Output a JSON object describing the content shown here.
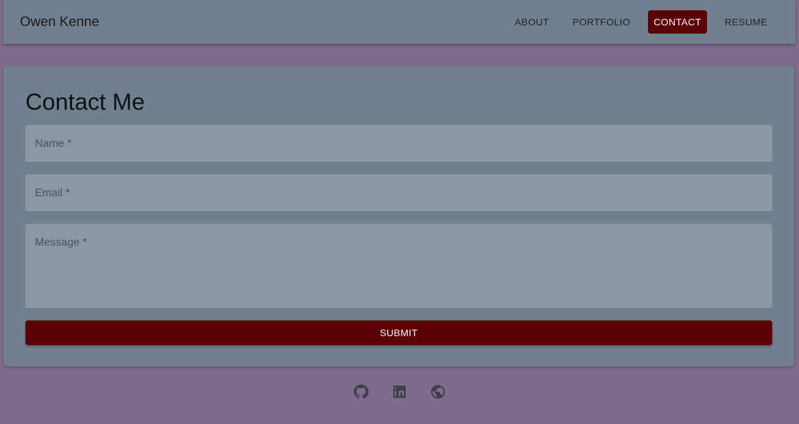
{
  "header": {
    "brand": "Owen Kenne",
    "nav": [
      {
        "label": "ABOUT",
        "active": false
      },
      {
        "label": "PORTFOLIO",
        "active": false
      },
      {
        "label": "CONTACT",
        "active": true
      },
      {
        "label": "RESUME",
        "active": false
      }
    ]
  },
  "contact": {
    "title": "Contact Me",
    "name_placeholder": "Name *",
    "email_placeholder": "Email *",
    "message_placeholder": "Message *",
    "submit_label": "SUBMIT"
  },
  "footer": {
    "icons": [
      "github-icon",
      "linkedin-icon",
      "globe-icon"
    ]
  },
  "colors": {
    "background": "#7f6c8c",
    "surface": "#70808e",
    "accent": "#5c0008"
  }
}
